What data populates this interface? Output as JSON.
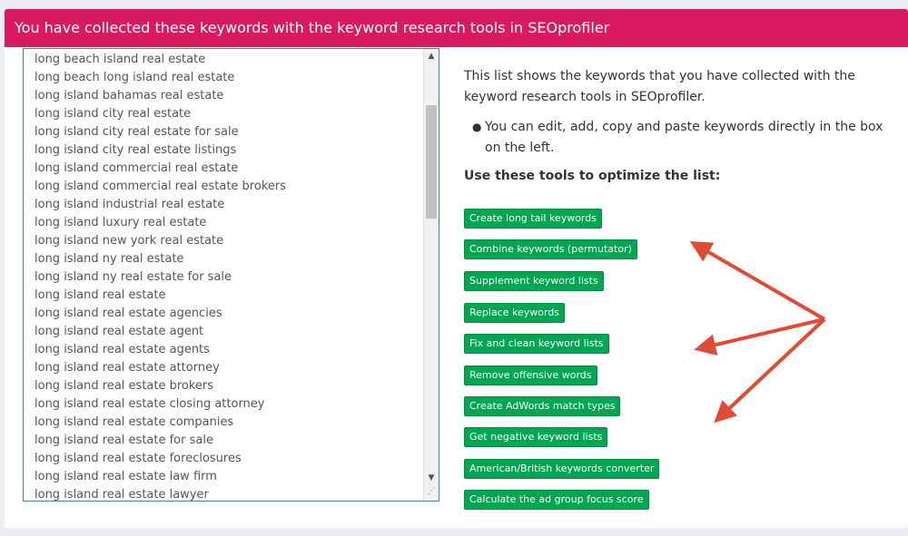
{
  "header": {
    "title": "You have collected these keywords with the keyword research tools in SEOprofiler"
  },
  "keywords": [
    "long beach island real estate",
    "long beach long island real estate",
    "long island bahamas real estate",
    "long island city real estate",
    "long island city real estate for sale",
    "long island city real estate listings",
    "long island commercial real estate",
    "long island commercial real estate brokers",
    "long island industrial real estate",
    "long island luxury real estate",
    "long island new york real estate",
    "long island ny real estate",
    "long island ny real estate for sale",
    "long island real estate",
    "long island real estate agencies",
    "long island real estate agent",
    "long island real estate agents",
    "long island real estate attorney",
    "long island real estate brokers",
    "long island real estate closing attorney",
    "long island real estate companies",
    "long island real estate for sale",
    "long island real estate foreclosures",
    "long island real estate law firm",
    "long island real estate lawyer"
  ],
  "info": {
    "description": "This list shows the keywords that you have collected with the keyword research tools in SEOprofiler.",
    "bullet": "You can edit, add, copy and paste keywords directly in the box on the left.",
    "tools_heading": "Use these tools to optimize the list:"
  },
  "tools": [
    "Create long tail keywords",
    "Combine keywords (permutator)",
    "Supplement keyword lists",
    "Replace keywords",
    "Fix and clean keyword lists",
    "Remove offensive words",
    "Create AdWords match types",
    "Get negative keyword lists",
    "American/British keywords converter",
    "Calculate the ad group focus score"
  ],
  "colors": {
    "header_bg": "#d81b60",
    "button_bg": "#00a651",
    "arrow": "#e04b36"
  },
  "icons": {
    "scroll_up": "▲",
    "scroll_down": "▼",
    "resize": "⋰",
    "bullet": "●"
  }
}
